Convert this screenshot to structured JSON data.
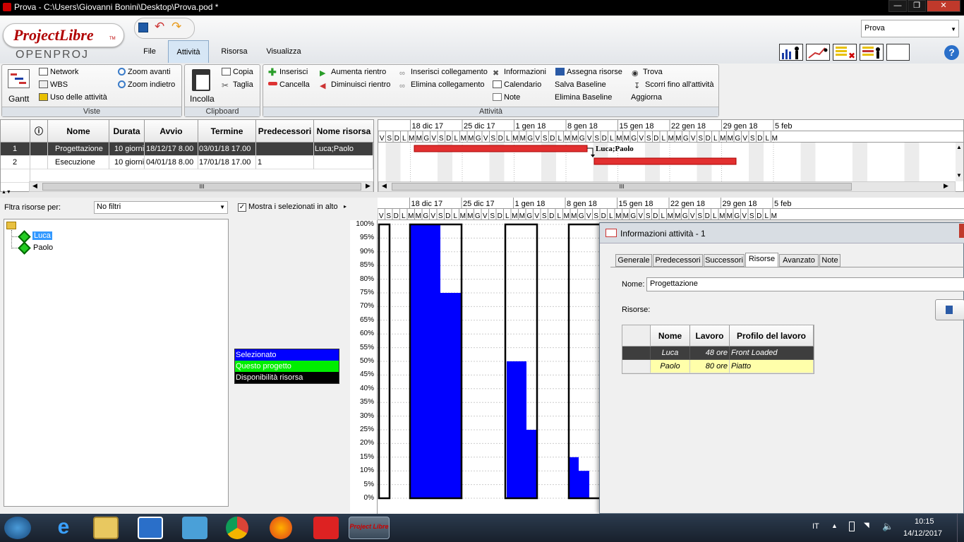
{
  "window": {
    "title": "Prova - C:\\Users\\Giovanni Bonini\\Desktop\\Prova.pod *"
  },
  "logo": {
    "brand": "ProjectLibre",
    "tm": "TM",
    "sub": "OPENPROJ"
  },
  "menu_tabs": [
    "File",
    "Attività",
    "Risorsa",
    "Visualizza"
  ],
  "project_combo": "Prova",
  "ribbon": {
    "gantt": "Gantt",
    "viste": {
      "network": "Network",
      "wbs": "WBS",
      "uso": "Uso delle attività",
      "zoom_in": "Zoom avanti",
      "zoom_out": "Zoom indietro",
      "label": "Viste"
    },
    "clipboard": {
      "paste": "Incolla",
      "copy": "Copia",
      "cut": "Taglia",
      "label": "Clipboard"
    },
    "attivita": {
      "inserisci": "Inserisci",
      "cancella": "Cancella",
      "aumenta": "Aumenta rientro",
      "diminuisci": "Diminuisci rientro",
      "ins_coll": "Inserisci collegamento",
      "elim_coll": "Elimina collegamento",
      "info": "Informazioni",
      "calendario": "Calendario",
      "note": "Note",
      "assegna": "Assegna risorse",
      "salva_base": "Salva Baseline",
      "elim_base": "Elimina Baseline",
      "trova": "Trova",
      "scorri": "Scorri fino all'attività",
      "aggiorna": "Aggiorna",
      "label": "Attività"
    }
  },
  "task_table": {
    "headers": [
      "Nome",
      "Durata",
      "Avvio",
      "Termine",
      "Predecessori",
      "Nome risorsa"
    ],
    "rows": [
      {
        "id": "1",
        "name": "Progettazione",
        "duration": "10 giorni",
        "start": "18/12/17 8.00",
        "end": "03/01/18 17.00",
        "pred": "",
        "res": "Luca;Paolo"
      },
      {
        "id": "2",
        "name": "Esecuzione",
        "duration": "10 giorni",
        "start": "04/01/18 8.00",
        "end": "17/01/18 17.00",
        "pred": "1",
        "res": ""
      }
    ],
    "scroll_mid": "III"
  },
  "timescale": {
    "weeks": [
      "18 dic 17",
      "25 dic 17",
      "1 gen 18",
      "8 gen 18",
      "15 gen 18",
      "22 gen 18",
      "29 gen 18",
      "5 feb"
    ],
    "leading_days": [
      "V",
      "S",
      "D"
    ],
    "week_days": [
      "L",
      "M",
      "M",
      "G",
      "V",
      "S",
      "D"
    ],
    "last_days": [
      "L",
      "M"
    ]
  },
  "gantt": {
    "bar_label": "Luca;Paolo",
    "bar_color": "#e23030"
  },
  "resource_panel": {
    "filter_label": "Fltra risorse per:",
    "filter_value": "No filtri",
    "show_selected": "Mostra i selezionati in alto",
    "resources": [
      "Luca",
      "Paolo"
    ],
    "legend": [
      {
        "label": "Selezionato",
        "color": "#0000ff",
        "text_color": "#ffffff"
      },
      {
        "label": "Questo progetto",
        "color": "#00ee00",
        "text_color": "#ffffff"
      },
      {
        "label": "Disponibilità risorsa",
        "color": "#000000",
        "text_color": "#ffffff"
      }
    ]
  },
  "histogram": {
    "y_ticks": [
      "100%",
      "95%",
      "90%",
      "85%",
      "80%",
      "75%",
      "70%",
      "65%",
      "60%",
      "55%",
      "50%",
      "45%",
      "40%",
      "35%",
      "30%",
      "25%",
      "20%",
      "15%",
      "10%",
      "5%",
      "0%"
    ]
  },
  "dialog": {
    "title": "Informazioni attività - 1",
    "tabs": [
      "Generale",
      "Predecessori",
      "Successori",
      "Risorse",
      "Avanzato",
      "Note"
    ],
    "name_label": "Nome:",
    "name_value": "Progettazione",
    "resources_label": "Risorse:",
    "table_headers": [
      "Nome",
      "Lavoro",
      "Profilo del lavoro"
    ],
    "table_rows": [
      {
        "name": "Luca",
        "work": "48 ore",
        "profile": "Front Loaded"
      },
      {
        "name": "Paolo",
        "work": "80 ore",
        "profile": "Piatto"
      }
    ]
  },
  "taskbar": {
    "active_app": "Project Libre",
    "lang": "IT",
    "time": "10:15",
    "date": "14/12/2017"
  }
}
